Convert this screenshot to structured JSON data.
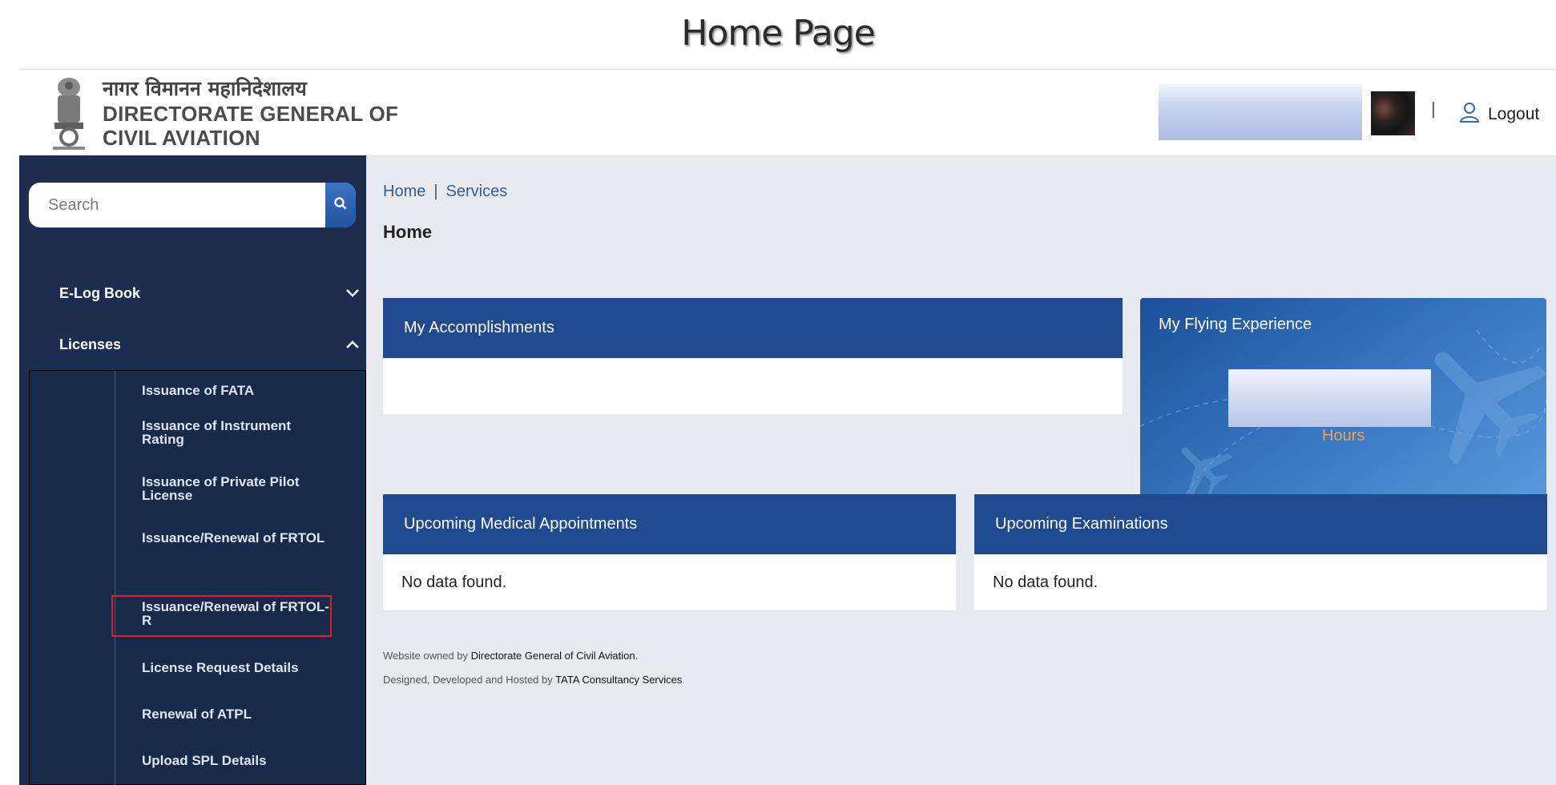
{
  "heading": "Home Page",
  "header": {
    "hindi_name": "नागर विमानन महानिदेशालय",
    "org_line1": "DIRECTORATE GENERAL OF",
    "org_line2": "CIVIL AVIATION",
    "separator": "|",
    "logout_label": "Logout"
  },
  "sidebar": {
    "search_placeholder": "Search",
    "menus": [
      {
        "label": "E-Log Book",
        "state": "collapsed"
      },
      {
        "label": "Licenses",
        "state": "expanded"
      }
    ],
    "license_items": [
      "Issuance of FATA",
      "Issuance of Instrument Rating",
      "Issuance of Private Pilot License",
      "Issuance/Renewal of FRTOL",
      "Issuance/Renewal of FRTOL-R",
      "License Request Details",
      "Renewal of ATPL",
      "Upload SPL Details"
    ],
    "highlighted_item": "Issuance/Renewal of FRTOL-R"
  },
  "main": {
    "breadcrumbs": [
      "Home",
      "Services"
    ],
    "breadcrumb_sep": "|",
    "title": "Home",
    "accomplishments": {
      "title": "My Accomplishments"
    },
    "flying": {
      "title": "My Flying Experience",
      "unit": "Hours"
    },
    "medical": {
      "title": "Upcoming Medical Appointments",
      "empty": "No data found."
    },
    "exams": {
      "title": "Upcoming Examinations",
      "empty": "No data found."
    }
  },
  "footer": {
    "owned_prefix": "Website owned by",
    "owned_by": "Directorate General of Civil Aviation.",
    "hosted_prefix": "Designed, Developed and Hosted by",
    "hosted_by": "TATA Consultancy Services"
  },
  "colors": {
    "sidebar": "#1c2d4f",
    "card_header": "#1f4a8f",
    "accent_orange": "#f0a050",
    "highlight": "#e02020"
  }
}
